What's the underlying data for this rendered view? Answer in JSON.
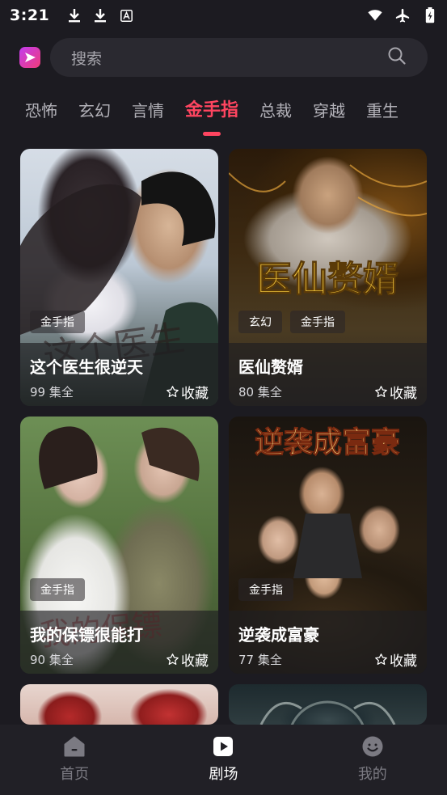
{
  "status_bar": {
    "time": "3:21",
    "notification_icons": [
      "download-icon",
      "download-icon",
      "font-icon"
    ],
    "system_icons": [
      "wifi-icon",
      "airplane-icon",
      "battery-charging-icon"
    ]
  },
  "header": {
    "search_placeholder": "搜索"
  },
  "tabs": [
    "恐怖",
    "玄幻",
    "言情",
    "金手指",
    "总裁",
    "穿越",
    "重生"
  ],
  "active_tab": "金手指",
  "cards": [
    {
      "title": "这个医生很逆天",
      "episodes": "99 集全",
      "tags": [
        "金手指"
      ],
      "fav_label": "收藏"
    },
    {
      "title": "医仙赘婿",
      "episodes": "80 集全",
      "tags": [
        "玄幻",
        "金手指"
      ],
      "fav_label": "收藏",
      "poster_text": "医仙赘婿"
    },
    {
      "title": "我的保镖很能打",
      "episodes": "90 集全",
      "tags": [
        "金手指"
      ],
      "fav_label": "收藏"
    },
    {
      "title": "逆袭成富豪",
      "episodes": "77 集全",
      "tags": [
        "金手指"
      ],
      "fav_label": "收藏",
      "poster_text": "逆袭成富豪"
    }
  ],
  "bottom_nav": [
    {
      "label": "首页",
      "icon": "home-icon"
    },
    {
      "label": "剧场",
      "icon": "play-icon"
    },
    {
      "label": "我的",
      "icon": "profile-icon"
    }
  ],
  "active_nav": "剧场",
  "colors": {
    "accent": "#ff4560",
    "background": "#1c1b21",
    "search_bg": "#2a2930"
  }
}
